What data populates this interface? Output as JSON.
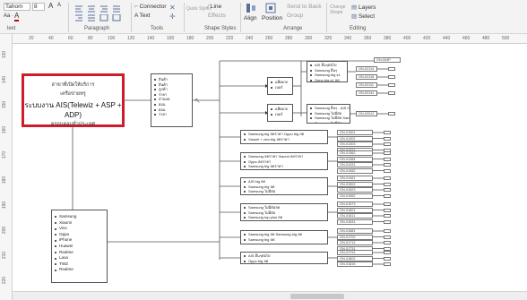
{
  "ribbon": {
    "font_name": "Tahom",
    "font_size": "8",
    "font_grow": "A",
    "font_shrink": "A",
    "font_color": "A",
    "groups": {
      "font": "lext",
      "paragraph": "Paragraph",
      "tools": "Tools",
      "shape_styles": "Shape Styles",
      "arrange": "Arrange",
      "editing": "Editing"
    },
    "tools": {
      "connector": "Connector",
      "text": "A Text"
    },
    "shape_styles": {
      "quick_styles": "Quick Styles",
      "line": "Line",
      "effects": "Effects"
    },
    "arrange": {
      "align": "Align",
      "position": "Position",
      "send_to_back": "Send to Back",
      "group": "Group"
    },
    "editing": {
      "change_shape": "Change Shape",
      "layers": "Layers",
      "select": "Select"
    }
  },
  "ruler": {
    "top_ticks": [
      "20",
      "40",
      "60",
      "80",
      "100",
      "120",
      "140",
      "160",
      "180",
      "200",
      "220",
      "240",
      "260",
      "280",
      "300",
      "320",
      "340",
      "360",
      "380",
      "400",
      "420",
      "440",
      "460",
      "480",
      "500"
    ],
    "left_ticks": [
      "130",
      "140",
      "150",
      "160",
      "170",
      "180",
      "190",
      "200",
      "210",
      "220"
    ]
  },
  "diagram": {
    "root": {
      "line1": "สาขาที่เปิดให้บริการ",
      "line2": "เครือข่ายทรู",
      "line3": "ระบบงาน AIS(Telewiz + ASP + ADP)",
      "line4": "ครอบคลุมทั่วประเทศ"
    },
    "brands_box": [
      "Samsung",
      "Xiaomi",
      "Vivo",
      "Oppo",
      "iPhone",
      "Huawei",
      "Realme",
      "Lava",
      "TWZ",
      "Realme"
    ],
    "mid_box": [
      "สินค้า",
      "สินค้า",
      "ลูกค้า",
      "ราคา",
      "ส่วนลด",
      "ผ่อน",
      "ผ่อน",
      "ราคา"
    ],
    "level2_top": [
      "แพ็คเกจ",
      "เบอร์"
    ],
    "level2_bottom": [
      "แพ็คเกจ",
      "เบอร์"
    ],
    "right_groups": [
      [
        "AIS อื่นๆต่อไป",
        "Samsung อื่นๆ",
        "Samsung big s1",
        "Oppo big s1 ลด"
      ],
      [
        "Samsung อื่นๆ - AIS OnTFR อื่นๆ",
        "Samsung ไม่มีต่อ",
        "Samsung ไม่มีต่อ Samsung",
        "Samsung ไม่มีต่อ"
      ],
      [
        "Samsung big ลดราคา Oppo big ลด",
        "Xiaomi + vivo big ลดราคา"
      ],
      [
        "Samsung ลดราคา Xiaomi ลดราคา",
        "Oppo ลดราคา",
        "Samsung big ลดราคา"
      ],
      [
        "AIS big ลด",
        "Samsung big ลด",
        "Samsung ไม่มีต่อ"
      ],
      [
        "Samsung ไม่มีต่อลด",
        "Samsung ไม่มีต่อ",
        "Samsung top plus ลด"
      ],
      [
        "Samsung big ลด Samsung big ลด",
        "Samsung big ลด"
      ],
      [
        "AIS อื่นๆต่อไป",
        "Oppo big ลด"
      ]
    ],
    "codes": [
      "ON-004P",
      "ON-02114",
      "ON-02116",
      "ON-02111",
      "ON-02141",
      "ON-02012",
      "ON-01301",
      "ON-01302",
      "ON-01303",
      "ON-01321",
      "ON-01362",
      "ON-01384",
      "ON-01431",
      "ON-01452",
      "ON-01461",
      "ON-01502",
      "ON-01523",
      "ON-01552",
      "ON-01573",
      "ON-01601",
      "ON-01611",
      "ON-01631",
      "ON-01681",
      "ON-01702",
      "ON-01712",
      "ON-01731",
      "ON-01791",
      "ON-01802",
      "ON-01815",
      "ON-01841"
    ]
  },
  "colors": {
    "ribbon_bg": "#f3f3f3",
    "highlight": "#d01c2a",
    "line": "#555555"
  }
}
